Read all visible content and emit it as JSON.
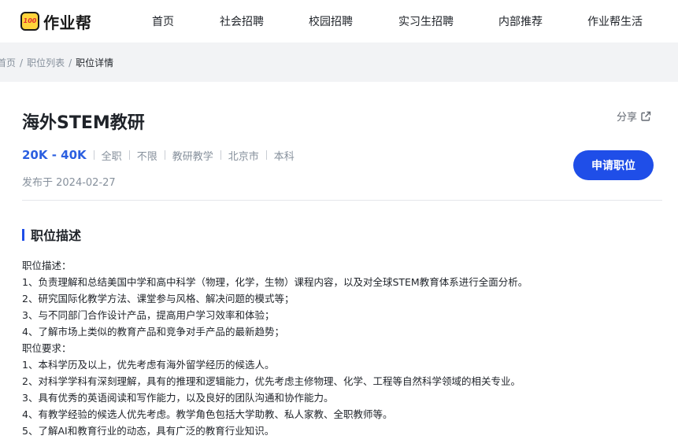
{
  "header": {
    "logo_badge": "100",
    "logo_text": "作业帮",
    "nav": [
      "首页",
      "社会招聘",
      "校园招聘",
      "实习生招聘",
      "内部推荐",
      "作业帮生活"
    ]
  },
  "breadcrumb": {
    "items": [
      "首页",
      "职位列表",
      "职位详情"
    ],
    "separator": "/"
  },
  "job": {
    "title": "海外STEM教研",
    "share_label": "分享",
    "salary": "20K - 40K",
    "tags": [
      "全职",
      "不限",
      "教研教学",
      "北京市",
      "本科"
    ],
    "posted": "发布于 2024-02-27",
    "apply_label": "申请职位"
  },
  "section": {
    "title": "职位描述",
    "lines": [
      "职位描述：",
      "1、负责理解和总结美国中学和高中科学（物理，化学，生物）课程内容，以及对全球STEM教育体系进行全面分析。",
      "2、研究国际化教学方法、课堂参与风格、解决问题的模式等；",
      "3、与不同部门合作设计产品，提高用户学习效率和体验；",
      "4、了解市场上类似的教育产品和竞争对手产品的最新趋势；",
      "职位要求：",
      "1、本科学历及以上，优先考虑有海外留学经历的候选人。",
      "2、对科学学科有深刻理解，具有的推理和逻辑能力，优先考虑主修物理、化学、工程等自然科学领域的相关专业。",
      "3、具有优秀的英语阅读和写作能力，以及良好的团队沟通和协作能力。",
      "4、有教学经验的候选人优先考虑。教学角色包括大学助教、私人家教、全职教师等。",
      "5、了解AI和教育行业的动态，具有广泛的教育行业知识。"
    ]
  },
  "colors": {
    "accent": "#1f4ee8",
    "salary": "#2b5fe0",
    "muted": "#86909c",
    "page_bg": "#f2f3f5"
  }
}
